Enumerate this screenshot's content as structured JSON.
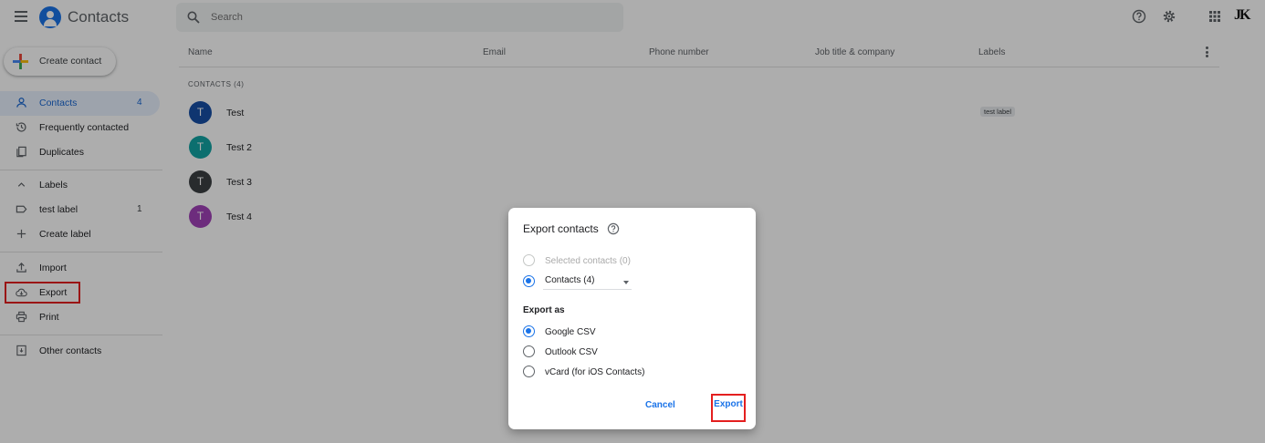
{
  "app": {
    "title": "Contacts"
  },
  "search": {
    "placeholder": "Search"
  },
  "sidebar": {
    "create_label": "Create contact",
    "items": [
      {
        "label": "Contacts",
        "count": "4",
        "icon": "person-icon"
      },
      {
        "label": "Frequently contacted",
        "icon": "history-icon"
      },
      {
        "label": "Duplicates",
        "icon": "duplicates-icon"
      }
    ],
    "labels_header": "Labels",
    "labels": [
      {
        "label": "test label",
        "count": "1"
      }
    ],
    "create_label_item": "Create label",
    "actions": [
      {
        "label": "Import",
        "icon": "import-icon"
      },
      {
        "label": "Export",
        "icon": "cloud-download-icon"
      },
      {
        "label": "Print",
        "icon": "print-icon"
      }
    ],
    "other_contacts": "Other contacts"
  },
  "table": {
    "columns": [
      "Name",
      "Email",
      "Phone number",
      "Job title & company",
      "Labels"
    ],
    "section_header": "CONTACTS (4)",
    "rows": [
      {
        "initial": "T",
        "name": "Test",
        "color": "#174ea6",
        "label": "test label"
      },
      {
        "initial": "T",
        "name": "Test 2",
        "color": "#12a4a4",
        "label": ""
      },
      {
        "initial": "T",
        "name": "Test 3",
        "color": "#3c4043",
        "label": ""
      },
      {
        "initial": "T",
        "name": "Test 4",
        "color": "#a142b8",
        "label": ""
      }
    ]
  },
  "topbar": {
    "avatar_text": "JK"
  },
  "dialog": {
    "title": "Export contacts",
    "options": [
      {
        "label": "Selected contacts (0)",
        "state": "disabled"
      },
      {
        "label": "Contacts (4)",
        "state": "checked"
      }
    ],
    "export_as_label": "Export as",
    "formats": [
      {
        "label": "Google CSV",
        "state": "checked"
      },
      {
        "label": "Outlook CSV",
        "state": "unchecked"
      },
      {
        "label": "vCard (for iOS Contacts)",
        "state": "unchecked"
      }
    ],
    "cancel_label": "Cancel",
    "export_label": "Export"
  },
  "colors": {
    "accent": "#1a73e8",
    "highlight_box": "#e41f1f",
    "scrim": "rgba(0,0,0,0.32)"
  }
}
